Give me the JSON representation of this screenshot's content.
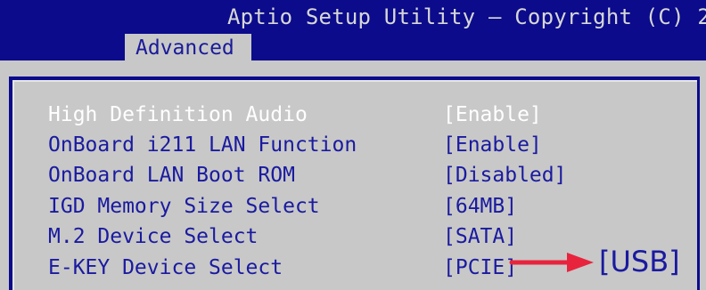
{
  "header": {
    "title": "Aptio Setup Utility – Copyright (C) 2",
    "active_tab": "Advanced"
  },
  "settings": [
    {
      "label": "High Definition Audio",
      "value": "[Enable]",
      "selected": true
    },
    {
      "label": "OnBoard i211 LAN Function",
      "value": "[Enable]",
      "selected": false
    },
    {
      "label": "OnBoard LAN Boot ROM",
      "value": "[Disabled]",
      "selected": false
    },
    {
      "label": "IGD Memory Size Select",
      "value": "[64MB]",
      "selected": false
    },
    {
      "label": "M.2 Device Select",
      "value": "[SATA]",
      "selected": false
    },
    {
      "label": "E-KEY Device Select",
      "value": "[PCIE]",
      "selected": false
    }
  ],
  "annotation": {
    "target_value": "[USB]",
    "arrow_icon": "right-arrow-icon",
    "arrow_color": "#e8243c"
  },
  "colors": {
    "title_bar": "#0b0b8c",
    "panel_background": "#c8c8c8",
    "item_text": "#1a1aa0",
    "selected_text": "#ffffff"
  }
}
